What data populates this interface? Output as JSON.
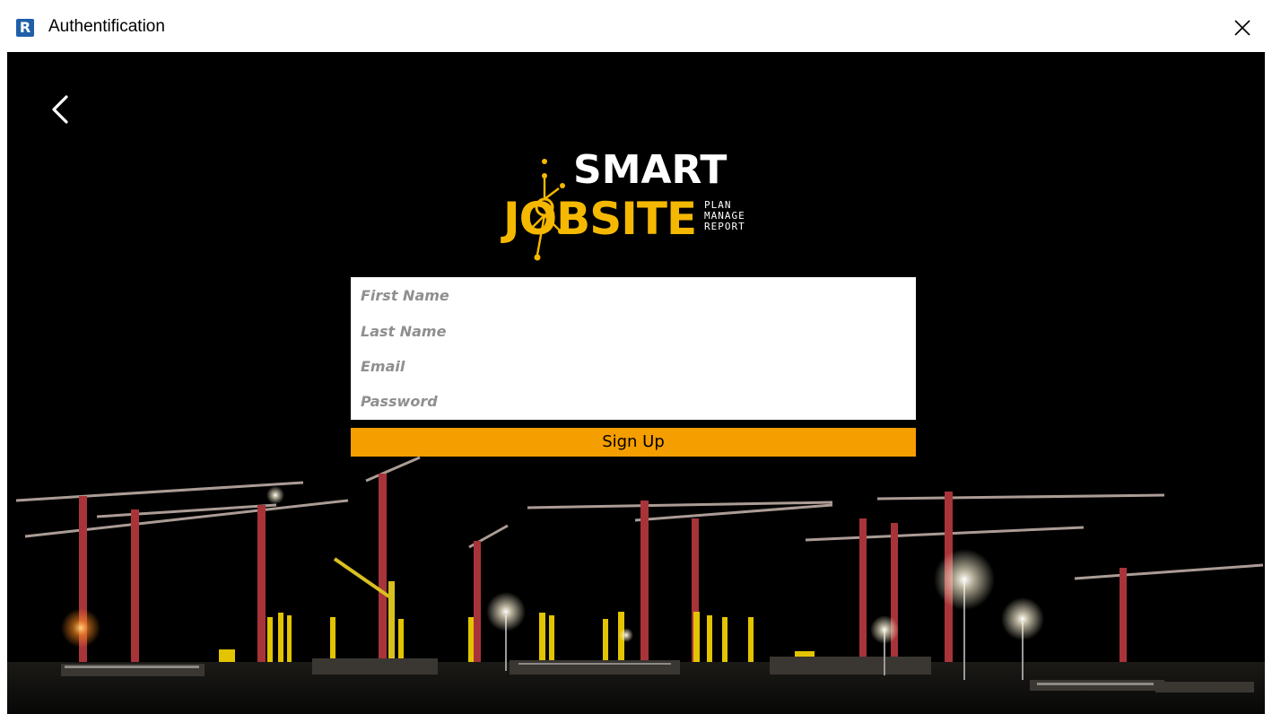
{
  "window": {
    "title": "Authentification",
    "icon_letter": "R",
    "icon_color": "#1f5fa8"
  },
  "navigation": {
    "back_icon": "chevron-left-icon",
    "close_icon": "close-icon"
  },
  "logo": {
    "word_top": "SMART",
    "word_main": "JOBSITE",
    "tagline": [
      "PLAN",
      "MANAGE",
      "REPORT"
    ],
    "accent_color": "#f5b800"
  },
  "form": {
    "first_name_placeholder": "First Name",
    "last_name_placeholder": "Last Name",
    "email_placeholder": "Email",
    "password_placeholder": "Password",
    "submit_label": "Sign Up",
    "submit_color": "#f59e00"
  },
  "background": {
    "scene": "construction site at night with tower cranes"
  }
}
